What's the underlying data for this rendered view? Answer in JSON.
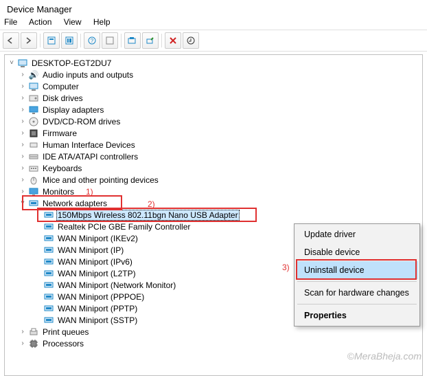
{
  "window": {
    "title": "Device Manager"
  },
  "menu": {
    "file": "File",
    "action": "Action",
    "view": "View",
    "help": "Help"
  },
  "annotations": {
    "a1": "1)",
    "a2": "2)",
    "a3": "3)"
  },
  "root": {
    "label": "DESKTOP-EGT2DU7"
  },
  "cats": {
    "audio": "Audio inputs and outputs",
    "computer": "Computer",
    "disk": "Disk drives",
    "display": "Display adapters",
    "dvd": "DVD/CD-ROM drives",
    "firmware": "Firmware",
    "hid": "Human Interface Devices",
    "ide": "IDE ATA/ATAPI controllers",
    "keyboards": "Keyboards",
    "mice": "Mice and other pointing devices",
    "monitors": "Monitors",
    "network": "Network adapters",
    "printq": "Print queues",
    "processors": "Processors"
  },
  "net": {
    "item0": "150Mbps Wireless 802.11bgn Nano USB Adapter",
    "item1": "Realtek PCIe GBE Family Controller",
    "item2": "WAN Miniport (IKEv2)",
    "item3": "WAN Miniport (IP)",
    "item4": "WAN Miniport (IPv6)",
    "item5": "WAN Miniport (L2TP)",
    "item6": "WAN Miniport (Network Monitor)",
    "item7": "WAN Miniport (PPPOE)",
    "item8": "WAN Miniport (PPTP)",
    "item9": "WAN Miniport (SSTP)"
  },
  "ctx": {
    "update": "Update driver",
    "disable": "Disable device",
    "uninstall": "Uninstall device",
    "scan": "Scan for hardware changes",
    "properties": "Properties"
  },
  "watermark": "©MeraBheja.com"
}
